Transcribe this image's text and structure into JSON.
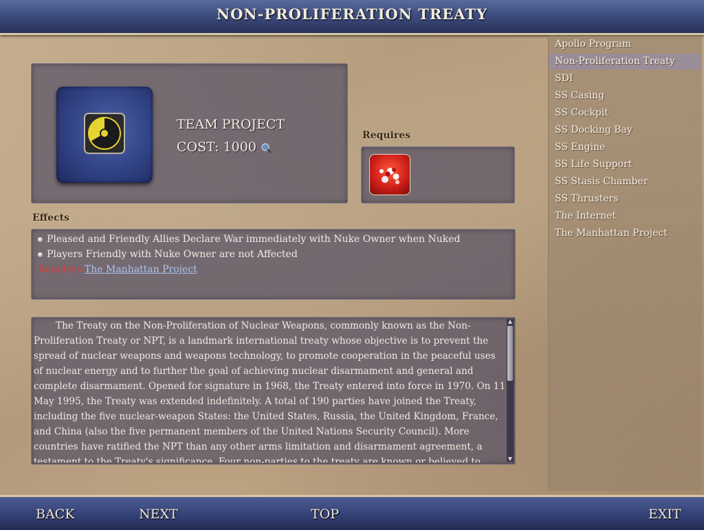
{
  "header": {
    "title": "NON-PROLIFERATION TREATY"
  },
  "project": {
    "icon": "radiation-icon",
    "type": "TEAM PROJECT",
    "cost_label": "COST:",
    "cost_value": "1000",
    "cost_icon": "research-beaker-icon"
  },
  "requires": {
    "label": "Requires",
    "icon": "atom-explosion-icon"
  },
  "effects": {
    "label": "Effects",
    "lines": [
      "Pleased and Friendly Allies Declare War immediately with Nuke Owner when Nuked",
      "Players Friendly with Nuke Owner are not Affected"
    ],
    "requires_prefix": "Requires",
    "requires_link": "The Manhattan Project"
  },
  "description": "The Treaty on the Non-Proliferation of Nuclear Weapons, commonly known as the Non-Proliferation Treaty or NPT, is a landmark international treaty whose objective is to prevent the spread of nuclear weapons and weapons technology, to promote cooperation in the peaceful uses of nuclear energy and to further the goal of achieving nuclear disarmament and general and complete disarmament. Opened for signature in 1968, the Treaty entered into force in 1970. On 11 May 1995, the Treaty was extended indefinitely. A total of 190 parties have joined the Treaty, including the five nuclear-weapon States: the United States, Russia, the United Kingdom, France, and China (also the five permanent members of the United Nations Security Council). More countries have ratified the NPT than any other arms limitation and disarmament agreement, a testament to the Treaty's significance. Four non-parties to the treaty are known or believed to possess nuclear weapons: India, Pakistan and North",
  "sidebar": {
    "selected_index": 1,
    "items": [
      "Apollo Program",
      "Non-Proliferation Treaty",
      "SDI",
      "SS Casing",
      "SS Cockpit",
      "SS Docking Bay",
      "SS Engine",
      "SS Life Support",
      "SS Stasis Chamber",
      "SS Thrusters",
      "The Internet",
      "The Manhattan Project"
    ]
  },
  "nav": {
    "back": "BACK",
    "next": "NEXT",
    "top": "TOP",
    "exit": "EXIT"
  },
  "colors": {
    "requires_prefix": "#e03a3a",
    "link": "#a9c4f0",
    "radiation_yellow": "#e6d230"
  }
}
